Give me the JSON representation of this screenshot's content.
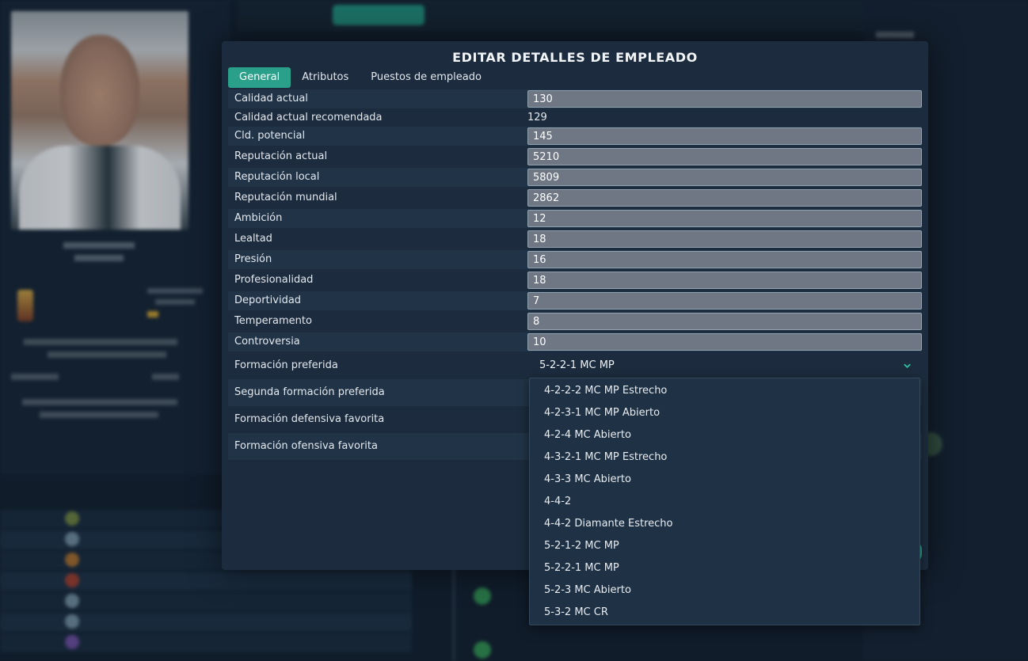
{
  "dialog": {
    "title": "EDITAR DETALLES DE EMPLEADO",
    "tabs": [
      "General",
      "Atributos",
      "Puestos de empleado"
    ],
    "active_tab": "General"
  },
  "fields": [
    {
      "label": "Calidad actual",
      "value": "130",
      "editable": true
    },
    {
      "label": "Calidad actual recomendada",
      "value": "129",
      "editable": false
    },
    {
      "label": "Cld. potencial",
      "value": "145",
      "editable": true
    },
    {
      "label": "Reputación actual",
      "value": "5210",
      "editable": true
    },
    {
      "label": "Reputación local",
      "value": "5809",
      "editable": true
    },
    {
      "label": "Reputación mundial",
      "value": "2862",
      "editable": true
    },
    {
      "label": "Ambición",
      "value": "12",
      "editable": true
    },
    {
      "label": "Lealtad",
      "value": "18",
      "editable": true
    },
    {
      "label": "Presión",
      "value": "16",
      "editable": true
    },
    {
      "label": "Profesionalidad",
      "value": "18",
      "editable": true
    },
    {
      "label": "Deportividad",
      "value": "7",
      "editable": true
    },
    {
      "label": "Temperamento",
      "value": "8",
      "editable": true
    },
    {
      "label": "Controversia",
      "value": "10",
      "editable": true
    }
  ],
  "formations": {
    "preferred_label": "Formación preferida",
    "preferred_value": "5-2-2-1 MC MP",
    "second_label": "Segunda formación preferida",
    "defensive_label": "Formación defensiva favorita",
    "offensive_label": "Formación ofensiva favorita"
  },
  "dropdown_options": [
    "4-2-2-2 MC MP Estrecho",
    "4-2-3-1 MC MP Abierto",
    "4-2-4 MC Abierto",
    "4-3-2-1 MC MP Estrecho",
    "4-3-3 MC Abierto",
    "4-4-2",
    "4-4-2 Diamante Estrecho",
    "5-2-1-2 MC MP",
    "5-2-2-1 MC MP",
    "5-2-3 MC Abierto",
    "5-3-2 MC CR"
  ],
  "colors": {
    "accent": "#2aa08a",
    "dialog_bg": "#1c2c3e",
    "field_bg": "#6e7783"
  }
}
